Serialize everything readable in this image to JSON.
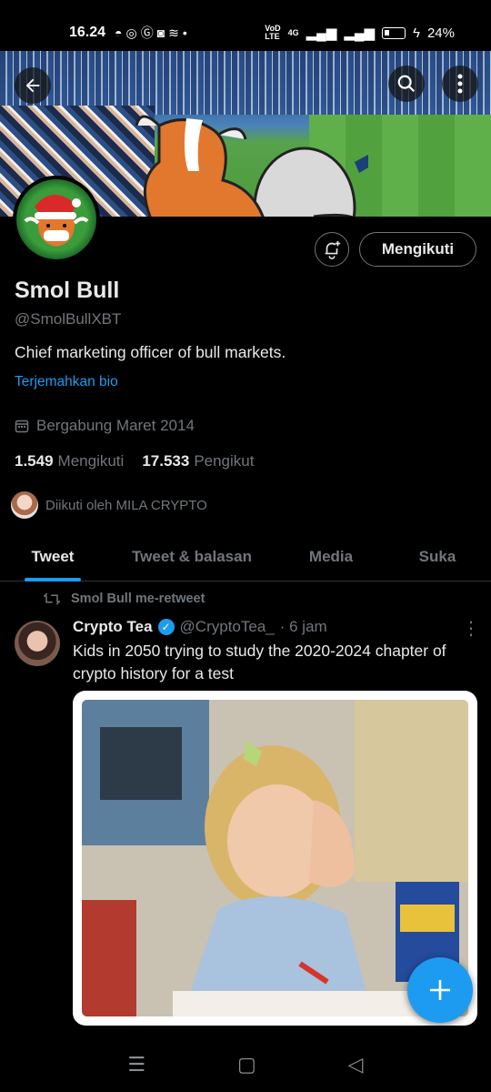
{
  "status_bar": {
    "time": "16.24",
    "left_icons": [
      "discord-icon",
      "camera-icon",
      "google-icon",
      "instagram-icon",
      "wifi-broadcast-icon",
      "dot"
    ],
    "volte": "VoD\nLTE",
    "network": "4G",
    "battery": "24%"
  },
  "profile": {
    "name": "Smol Bull",
    "handle": "@SmolBullXBT",
    "bio": "Chief marketing officer of bull markets.",
    "translate_link": "Terjemahkan bio",
    "joined": "Bergabung Maret 2014",
    "following_count": "1.549",
    "following_label": "Mengikuti",
    "followers_count": "17.533",
    "followers_label": "Pengikut",
    "followed_by": "Diikuti oleh MILA CRYPTO",
    "follow_button": "Mengikuti"
  },
  "tabs": [
    {
      "label": "Tweet",
      "active": true
    },
    {
      "label": "Tweet & balasan",
      "active": false
    },
    {
      "label": "Media",
      "active": false
    },
    {
      "label": "Suka",
      "active": false
    }
  ],
  "tweet": {
    "retweet_label": "Smol Bull me-retweet",
    "author": "Crypto Tea",
    "handle": "@CryptoTea_",
    "time": "· 6 jam",
    "text": "Kids in 2050 trying to study the 2020-2024 chapter of crypto history for a test"
  },
  "colors": {
    "accent": "#1d9bf0",
    "background": "#000000",
    "secondary_text": "#71767b"
  }
}
